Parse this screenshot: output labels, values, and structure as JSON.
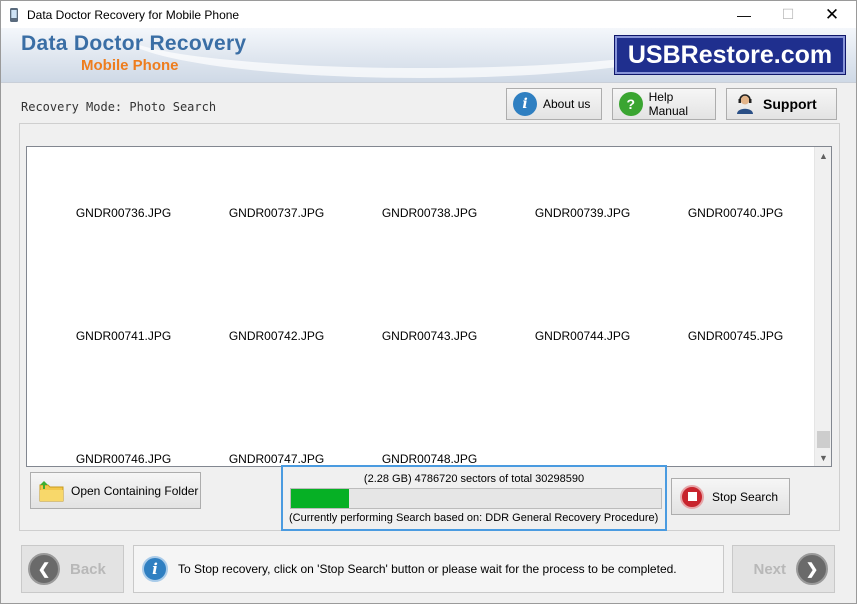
{
  "window": {
    "title": "Data Doctor Recovery for Mobile Phone",
    "minimize_glyph": "—",
    "maximize_glyph": "☐",
    "close_glyph": "✕"
  },
  "banner": {
    "title": "Data Doctor Recovery",
    "subtitle": "Mobile Phone",
    "logo_text": "USBRestore.com"
  },
  "header": {
    "mode_label": "Recovery Mode: Photo Search",
    "about_label": "About us",
    "help_label": "Help Manual",
    "support_label": "Support"
  },
  "gallery": {
    "items": [
      {
        "name": "GNDR00736.JPG"
      },
      {
        "name": "GNDR00737.JPG"
      },
      {
        "name": "GNDR00738.JPG"
      },
      {
        "name": "GNDR00739.JPG"
      },
      {
        "name": "GNDR00740.JPG"
      },
      {
        "name": "GNDR00741.JPG"
      },
      {
        "name": "GNDR00742.JPG"
      },
      {
        "name": "GNDR00743.JPG"
      },
      {
        "name": "GNDR00744.JPG"
      },
      {
        "name": "GNDR00745.JPG"
      },
      {
        "name": "GNDR00746.JPG"
      },
      {
        "name": "GNDR00747.JPG"
      },
      {
        "name": "GNDR00748.JPG"
      }
    ]
  },
  "actions": {
    "open_folder_label": "Open Containing Folder",
    "stop_search_label": "Stop Search"
  },
  "progress": {
    "sectors_text": "(2.28 GB) 4786720  sectors  of  total 30298590",
    "fraction": 0.158,
    "status_text": "(Currently performing Search based on:  DDR General Recovery Procedure)"
  },
  "footer": {
    "back_label": "Back",
    "next_label": "Next",
    "info_text": "To Stop recovery, click on 'Stop Search' button or please wait for the process to be completed."
  },
  "colors": {
    "brand_blue": "#3a6ea5",
    "brand_orange": "#ee7d1e",
    "progress_green": "#06b025",
    "selection_blue": "#4a9be0"
  }
}
